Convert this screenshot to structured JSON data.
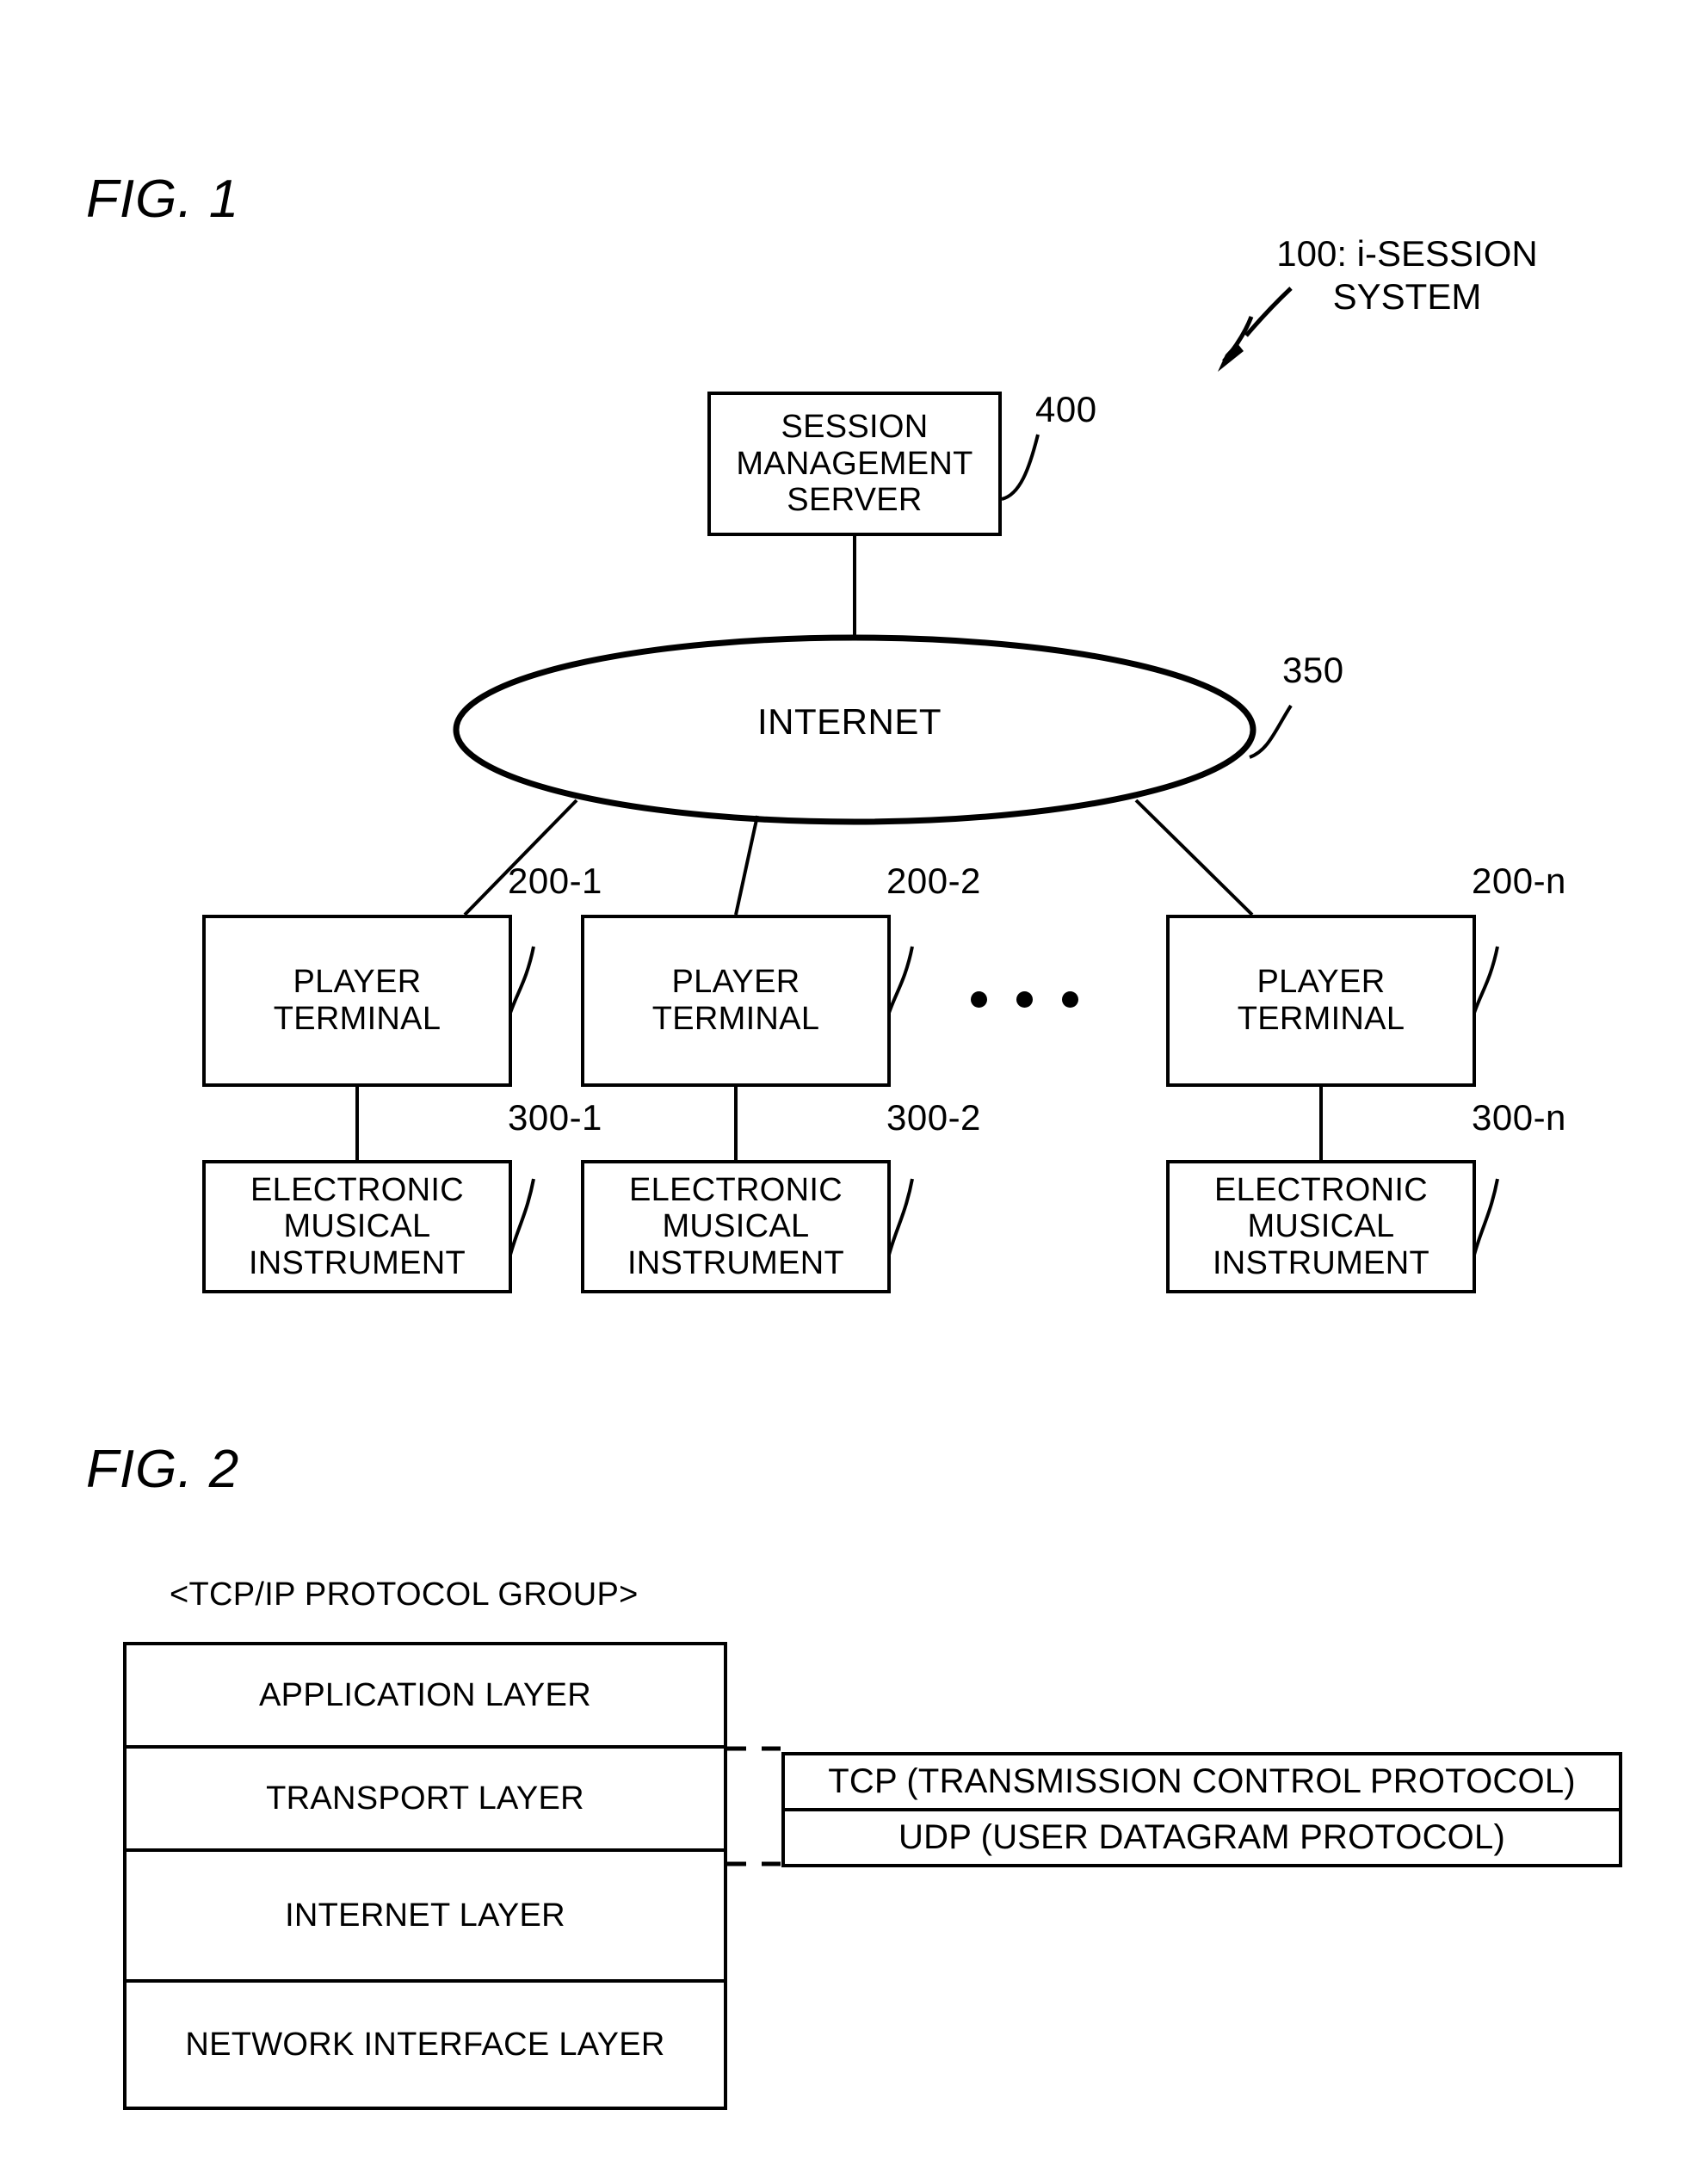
{
  "figures": [
    {
      "label": "FIG. 1",
      "system_caption_line1": "100: i-SESSION",
      "system_caption_line2": "SYSTEM",
      "server": {
        "line1": "SESSION",
        "line2": "MANAGEMENT",
        "line3": "SERVER",
        "ref": "400"
      },
      "network": {
        "label": "INTERNET",
        "ref": "350"
      },
      "ellipsis": "• • •",
      "terminals": [
        {
          "terminal_line1": "PLAYER",
          "terminal_line2": "TERMINAL",
          "terminal_ref": "200-1",
          "instrument_line1": "ELECTRONIC",
          "instrument_line2": "MUSICAL",
          "instrument_line3": "INSTRUMENT",
          "instrument_ref": "300-1"
        },
        {
          "terminal_line1": "PLAYER",
          "terminal_line2": "TERMINAL",
          "terminal_ref": "200-2",
          "instrument_line1": "ELECTRONIC",
          "instrument_line2": "MUSICAL",
          "instrument_line3": "INSTRUMENT",
          "instrument_ref": "300-2"
        },
        {
          "terminal_line1": "PLAYER",
          "terminal_line2": "TERMINAL",
          "terminal_ref": "200-n",
          "instrument_line1": "ELECTRONIC",
          "instrument_line2": "MUSICAL",
          "instrument_line3": "INSTRUMENT",
          "instrument_ref": "300-n"
        }
      ]
    },
    {
      "label": "FIG. 2",
      "stack_caption": "<TCP/IP PROTOCOL GROUP>",
      "layers": [
        "APPLICATION LAYER",
        "TRANSPORT LAYER",
        "INTERNET LAYER",
        "NETWORK INTERFACE LAYER"
      ],
      "protocols": [
        "TCP (TRANSMISSION CONTROL PROTOCOL)",
        "UDP (USER DATAGRAM PROTOCOL)"
      ]
    }
  ],
  "colors": {
    "ink": "#000000",
    "paper": "#ffffff"
  }
}
